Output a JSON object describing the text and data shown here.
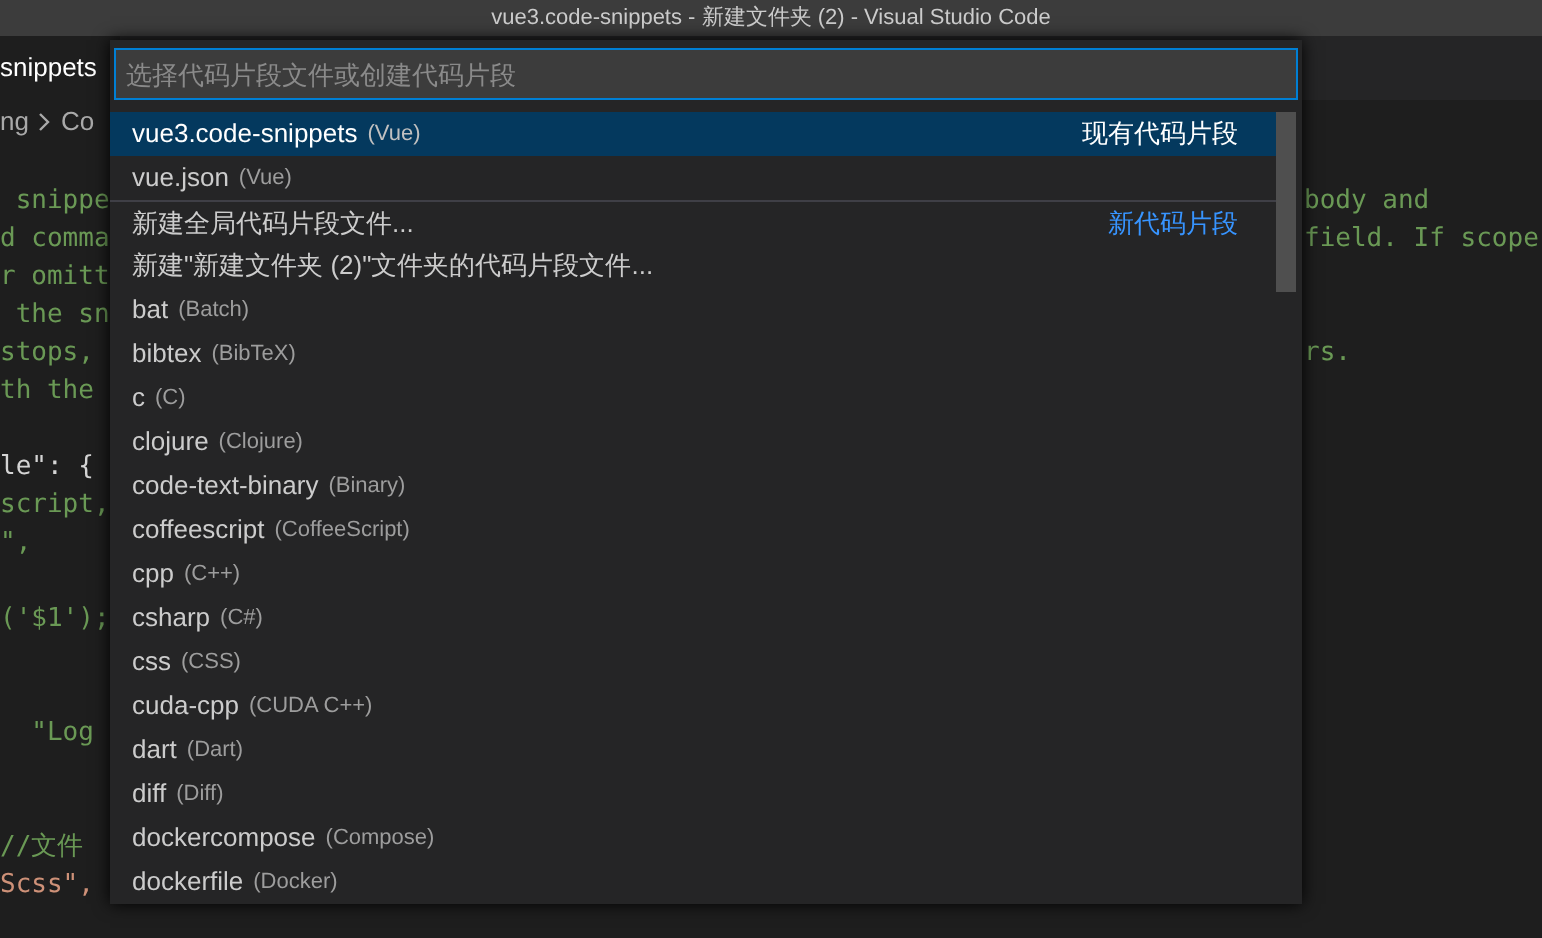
{
  "window": {
    "title": "vue3.code-snippets - 新建文件夹 (2) - Visual Studio Code"
  },
  "tab": {
    "label": "snippets"
  },
  "breadcrumb": [
    "ng",
    "Co"
  ],
  "editor_lines": [
    {
      "left": " snippe",
      "right": "body and",
      "kind": "comment"
    },
    {
      "left": "d comma",
      "right": "field. If scope",
      "kind": "comment"
    },
    {
      "left": "r omitt",
      "kind": "comment"
    },
    {
      "left": " the sn",
      "kind": "comment"
    },
    {
      "left": "stops,",
      "right": "rs.",
      "kind": "comment"
    },
    {
      "left": "th the",
      "kind": "comment"
    },
    {
      "kind": "blank"
    },
    {
      "left": "le\": {",
      "kind": "plain"
    },
    {
      "left": "script,",
      "kind": "comment"
    },
    {
      "left": "\",",
      "kind": "comment"
    },
    {
      "kind": "blank"
    },
    {
      "left": "('$1');",
      "kind": "comment"
    },
    {
      "kind": "blank"
    },
    {
      "kind": "blank"
    },
    {
      "left": "  \"Log",
      "kind": "comment"
    },
    {
      "kind": "blank"
    },
    {
      "kind": "blank"
    },
    {
      "left": "//文件",
      "kind": "comment"
    },
    {
      "left": "Scss\",",
      "kind": "string"
    }
  ],
  "quick_pick": {
    "placeholder": "选择代码片段文件或创建代码片段",
    "items": [
      {
        "label": "vue3.code-snippets",
        "description": "(Vue)",
        "group_label": "现有代码片段",
        "selected": true,
        "separator": false
      },
      {
        "label": "vue.json",
        "description": "(Vue)",
        "selected": false,
        "separator": false
      },
      {
        "label": "新建全局代码片段文件...",
        "group_label": "新代码片段",
        "selected": false,
        "separator": true
      },
      {
        "label": "新建\"新建文件夹 (2)\"文件夹的代码片段文件...",
        "selected": false,
        "separator": false
      },
      {
        "label": "bat",
        "description": "(Batch)",
        "selected": false,
        "separator": false
      },
      {
        "label": "bibtex",
        "description": "(BibTeX)",
        "selected": false,
        "separator": false
      },
      {
        "label": "c",
        "description": "(C)",
        "selected": false,
        "separator": false
      },
      {
        "label": "clojure",
        "description": "(Clojure)",
        "selected": false,
        "separator": false
      },
      {
        "label": "code-text-binary",
        "description": "(Binary)",
        "selected": false,
        "separator": false
      },
      {
        "label": "coffeescript",
        "description": "(CoffeeScript)",
        "selected": false,
        "separator": false
      },
      {
        "label": "cpp",
        "description": "(C++)",
        "selected": false,
        "separator": false
      },
      {
        "label": "csharp",
        "description": "(C#)",
        "selected": false,
        "separator": false
      },
      {
        "label": "css",
        "description": "(CSS)",
        "selected": false,
        "separator": false
      },
      {
        "label": "cuda-cpp",
        "description": "(CUDA C++)",
        "selected": false,
        "separator": false
      },
      {
        "label": "dart",
        "description": "(Dart)",
        "selected": false,
        "separator": false
      },
      {
        "label": "diff",
        "description": "(Diff)",
        "selected": false,
        "separator": false
      },
      {
        "label": "dockercompose",
        "description": "(Compose)",
        "selected": false,
        "separator": false
      },
      {
        "label": "dockerfile",
        "description": "(Docker)",
        "selected": false,
        "separator": false
      }
    ]
  }
}
